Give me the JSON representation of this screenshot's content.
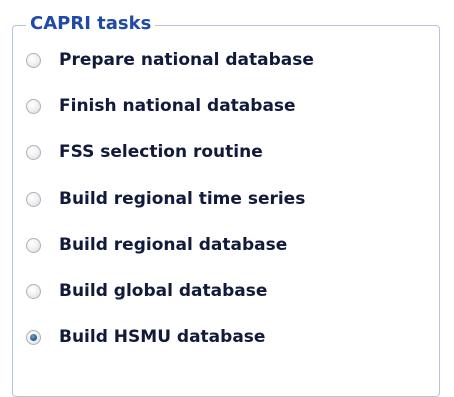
{
  "group": {
    "title": "CAPRI tasks"
  },
  "tasks": [
    {
      "label": "Prepare national database",
      "selected": false
    },
    {
      "label": "Finish national database",
      "selected": false
    },
    {
      "label": "FSS selection routine",
      "selected": false
    },
    {
      "label": "Build regional time series",
      "selected": false
    },
    {
      "label": "Build regional database",
      "selected": false
    },
    {
      "label": "Build global database",
      "selected": false
    },
    {
      "label": "Build HSMU database",
      "selected": true
    }
  ]
}
